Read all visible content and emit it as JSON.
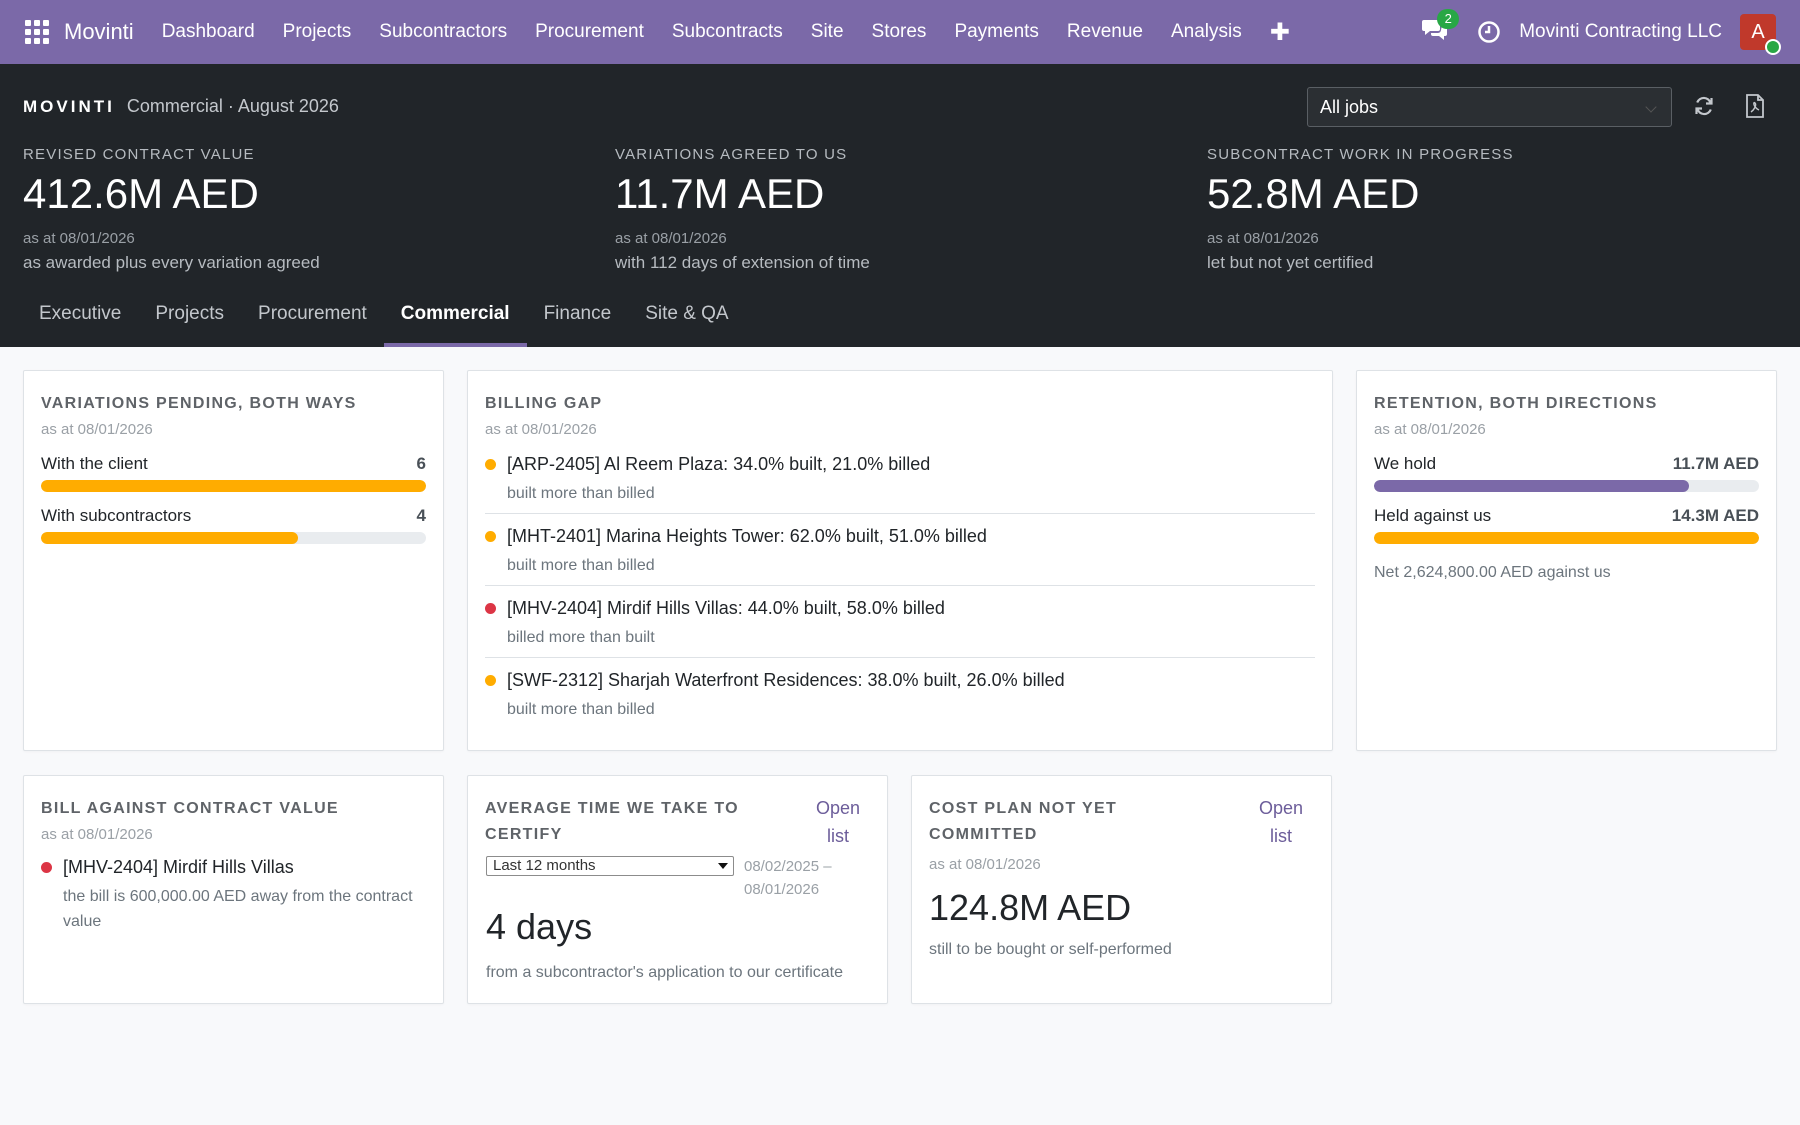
{
  "topnav": {
    "brand": "Movinti",
    "menu": [
      "Dashboard",
      "Projects",
      "Subcontractors",
      "Procurement",
      "Subcontracts",
      "Site",
      "Stores",
      "Payments",
      "Revenue",
      "Analysis"
    ],
    "messages_count": "2",
    "company": "Movinti Contracting LLC",
    "avatar_initial": "A"
  },
  "header": {
    "logo": "MOVINTI",
    "subtitle": "Commercial · August 2026",
    "job_filter": "All jobs",
    "kpis": [
      {
        "label": "Revised contract value",
        "value": "412.6M AED",
        "as_at": "as at 08/01/2026",
        "note": "as awarded plus every variation agreed"
      },
      {
        "label": "Variations agreed to us",
        "value": "11.7M AED",
        "as_at": "as at 08/01/2026",
        "note": "with 112 days of extension of time"
      },
      {
        "label": "Subcontract work in progress",
        "value": "52.8M AED",
        "as_at": "as at 08/01/2026",
        "note": "let but not yet certified"
      }
    ],
    "tabs": [
      "Executive",
      "Projects",
      "Procurement",
      "Commercial",
      "Finance",
      "Site & QA"
    ],
    "active_tab": "Commercial"
  },
  "variations": {
    "title": "Variations pending, both ways",
    "as_at": "as at 08/01/2026",
    "rows": [
      {
        "label": "With the client",
        "value": "6",
        "count": 6,
        "max": 6,
        "color": "#ffac00"
      },
      {
        "label": "With subcontractors",
        "value": "4",
        "count": 4,
        "max": 6,
        "color": "#ffac00"
      }
    ]
  },
  "billing_gap": {
    "title": "Billing gap",
    "as_at": "as at 08/01/2026",
    "items": [
      {
        "text": "[ARP-2405] Al Reem Plaza: 34.0% built, 21.0% billed",
        "note": "built more than billed",
        "color": "#ffac00"
      },
      {
        "text": "[MHT-2401] Marina Heights Tower: 62.0% built, 51.0% billed",
        "note": "built more than billed",
        "color": "#ffac00"
      },
      {
        "text": "[MHV-2404] Mirdif Hills Villas: 44.0% built, 58.0% billed",
        "note": "billed more than built",
        "color": "#dc3545"
      },
      {
        "text": "[SWF-2312] Sharjah Waterfront Residences: 38.0% built, 26.0% billed",
        "note": "built more than billed",
        "color": "#ffac00"
      }
    ]
  },
  "retention": {
    "title": "Retention, both directions",
    "as_at": "as at 08/01/2026",
    "rows": [
      {
        "label": "We hold",
        "value": "11.7M AED",
        "amount": 11.7,
        "max": 14.3,
        "color": "#7b69a8"
      },
      {
        "label": "Held against us",
        "value": "14.3M AED",
        "amount": 14.3,
        "max": 14.3,
        "color": "#ffac00"
      }
    ],
    "net": "Net 2,624,800.00 AED against us"
  },
  "bill_vs_contract": {
    "title": "Bill against contract value",
    "as_at": "as at 08/01/2026",
    "items": [
      {
        "text": "[MHV-2404] Mirdif Hills Villas",
        "note": "the bill is 600,000.00 AED away from the contract value",
        "color": "#dc3545"
      }
    ]
  },
  "certify_time": {
    "title": "Average time we take to certify",
    "link": "Open list",
    "period": "Last 12 months",
    "range": "08/02/2025 – 08/01/2026",
    "value": "4 days",
    "note": "from a subcontractor's application to our certificate"
  },
  "cost_plan": {
    "title": "Cost plan not yet committed",
    "link": "Open list",
    "as_at": "as at 08/01/2026",
    "value": "124.8M AED",
    "note": "still to be bought or self-performed"
  }
}
